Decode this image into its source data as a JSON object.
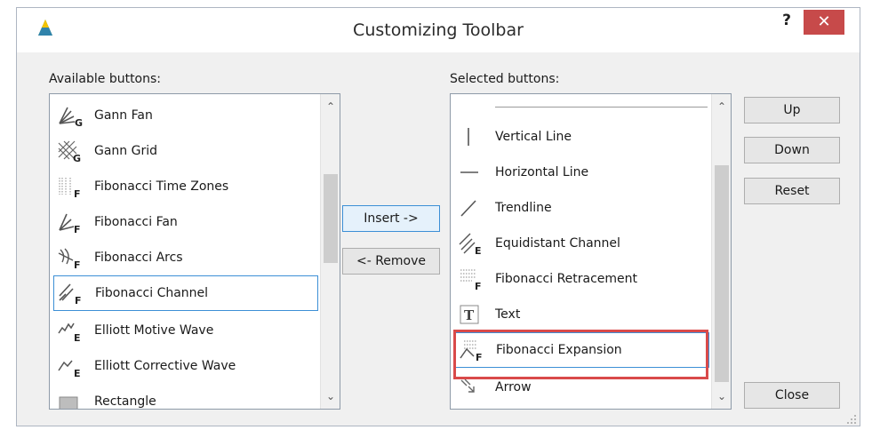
{
  "window": {
    "title": "Customizing Toolbar",
    "help_label": "?",
    "close_label": "✕"
  },
  "available": {
    "label": "Available buttons:",
    "items": [
      {
        "label": "Gann Fan",
        "icon": "gann-fan-icon"
      },
      {
        "label": "Gann Grid",
        "icon": "gann-grid-icon"
      },
      {
        "label": "Fibonacci Time Zones",
        "icon": "fibonacci-time-zones-icon"
      },
      {
        "label": "Fibonacci Fan",
        "icon": "fibonacci-fan-icon"
      },
      {
        "label": "Fibonacci Arcs",
        "icon": "fibonacci-arcs-icon"
      },
      {
        "label": "Fibonacci Channel",
        "icon": "fibonacci-channel-icon",
        "selected": true
      },
      {
        "label": "Elliott Motive Wave",
        "icon": "elliott-motive-wave-icon"
      },
      {
        "label": "Elliott Corrective Wave",
        "icon": "elliott-corrective-wave-icon"
      },
      {
        "label": "Rectangle",
        "icon": "rectangle-icon"
      }
    ]
  },
  "middle": {
    "insert_label": "Insert ->",
    "remove_label": "<- Remove"
  },
  "selected": {
    "label": "Selected buttons:",
    "items": [
      {
        "label": "Vertical Line",
        "icon": "vertical-line-icon"
      },
      {
        "label": "Horizontal Line",
        "icon": "horizontal-line-icon"
      },
      {
        "label": "Trendline",
        "icon": "trendline-icon"
      },
      {
        "label": "Equidistant Channel",
        "icon": "equidistant-channel-icon"
      },
      {
        "label": "Fibonacci Retracement",
        "icon": "fibonacci-retracement-icon"
      },
      {
        "label": "Text",
        "icon": "text-icon"
      },
      {
        "label": "Fibonacci Expansion",
        "icon": "fibonacci-expansion-icon",
        "selected": true
      },
      {
        "label": "Arrow",
        "icon": "arrow-icon"
      }
    ]
  },
  "right": {
    "up_label": "Up",
    "down_label": "Down",
    "reset_label": "Reset",
    "close_label": "Close"
  },
  "colors": {
    "highlight": "#d94a4a",
    "selection": "#3c8fd6",
    "close_bg": "#c74a4a"
  }
}
